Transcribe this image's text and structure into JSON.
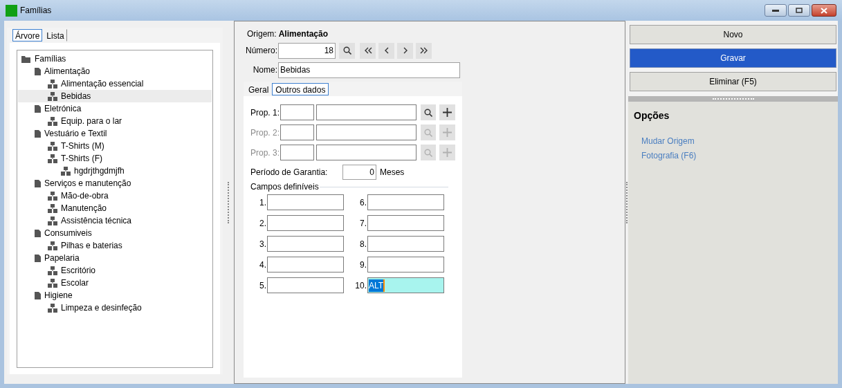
{
  "window": {
    "title": "Famílias"
  },
  "left_tabs": [
    {
      "label": "Árvore",
      "selected": true
    },
    {
      "label": "Lista",
      "selected": false
    }
  ],
  "tree": [
    {
      "label": "Famílias",
      "selected": false,
      "children": [
        {
          "label": "Alimentação",
          "selected": false,
          "children": [
            {
              "label": "Alimentação essencial",
              "selected": false
            },
            {
              "label": "Bebidas",
              "selected": true
            }
          ]
        },
        {
          "label": "Eletrónica",
          "selected": false,
          "children": [
            {
              "label": "Equip. para o lar",
              "selected": false
            }
          ]
        },
        {
          "label": "Vestuário e Textil",
          "selected": false,
          "children": [
            {
              "label": "T-Shirts (M)",
              "selected": false
            },
            {
              "label": "T-Shirts (F)",
              "selected": false,
              "children": [
                {
                  "label": "hgdrjthgdmjfh",
                  "selected": false
                }
              ]
            }
          ]
        },
        {
          "label": "Serviços e manutenção",
          "selected": false,
          "children": [
            {
              "label": "Mão-de-obra",
              "selected": false
            },
            {
              "label": "Manutenção",
              "selected": false
            },
            {
              "label": "Assistência técnica",
              "selected": false
            }
          ]
        },
        {
          "label": "Consumiveis",
          "selected": false,
          "children": [
            {
              "label": "Pilhas e baterias",
              "selected": false
            }
          ]
        },
        {
          "label": "Papelaria",
          "selected": false,
          "children": [
            {
              "label": "Escritório",
              "selected": false
            },
            {
              "label": "Escolar",
              "selected": false
            }
          ]
        },
        {
          "label": "Higiene",
          "selected": false,
          "children": [
            {
              "label": "Limpeza e desinfeção",
              "selected": false
            }
          ]
        }
      ]
    }
  ],
  "form": {
    "origin_label": "Origem:",
    "origin_value": "Alimentação",
    "number_label": "Número:",
    "number_value": "18",
    "name_label": "Nome:",
    "name_value": "Bebidas"
  },
  "form_tabs": [
    {
      "label": "Geral",
      "selected": false
    },
    {
      "label": "Outros dados",
      "selected": true
    }
  ],
  "properties": [
    {
      "label": "Prop. 1:",
      "disabled": false
    },
    {
      "label": "Prop. 2:",
      "disabled": true
    },
    {
      "label": "Prop. 3:",
      "disabled": true
    }
  ],
  "warranty": {
    "label": "Período de Garantia:",
    "value": "0",
    "unit": "Meses"
  },
  "custom_fields": {
    "title": "Campos definíveis",
    "fields": [
      {
        "label": "1.",
        "focused": false
      },
      {
        "label": "2.",
        "focused": false
      },
      {
        "label": "3.",
        "focused": false
      },
      {
        "label": "4.",
        "focused": false
      },
      {
        "label": "5.",
        "focused": false
      },
      {
        "label": "6.",
        "focused": false
      },
      {
        "label": "7.",
        "focused": false
      },
      {
        "label": "8.",
        "focused": false
      },
      {
        "label": "9.",
        "focused": false
      },
      {
        "label": "10.",
        "value": "ALT",
        "focused": true
      }
    ]
  },
  "actions": [
    {
      "label": "Novo",
      "primary": false
    },
    {
      "label": "Gravar",
      "primary": true
    },
    {
      "label": "Eliminar (F5)",
      "primary": false
    }
  ],
  "options": {
    "title": "Opções",
    "links": [
      "Mudar Origem",
      "Fotografia (F6)"
    ]
  }
}
